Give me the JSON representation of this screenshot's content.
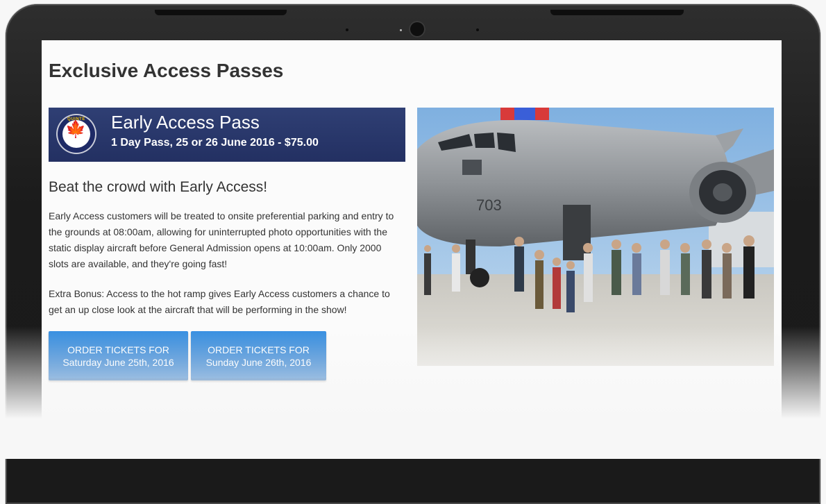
{
  "page": {
    "title": "Exclusive Access Passes"
  },
  "pass": {
    "badge_text": "QUINTE",
    "name": "Early Access Pass",
    "detail": "1 Day Pass, 25 or 26 June 2016 - $75.00"
  },
  "content": {
    "heading": "Beat the crowd with Early Access!",
    "paragraph1": "Early Access customers will be treated to onsite preferential parking and entry to the grounds at 08:00am, allowing for uninterrupted photo opportunities with the static display aircraft before General Admission opens at 10:00am. Only 2000 slots are available, and they're going fast!",
    "paragraph2": "Extra Bonus: Access to the hot ramp gives Early Access customers a chance to get an up close look at the aircraft that will be performing in the show!"
  },
  "buttons": [
    {
      "line1": "ORDER TICKETS FOR",
      "line2": "Saturday June 25th, 2016"
    },
    {
      "line1": "ORDER TICKETS FOR",
      "line2": "Sunday June 26th, 2016"
    }
  ],
  "photo": {
    "tail_number": "703"
  },
  "colors": {
    "banner": "#2a386b",
    "button": "#2a80d6",
    "text": "#333333"
  }
}
